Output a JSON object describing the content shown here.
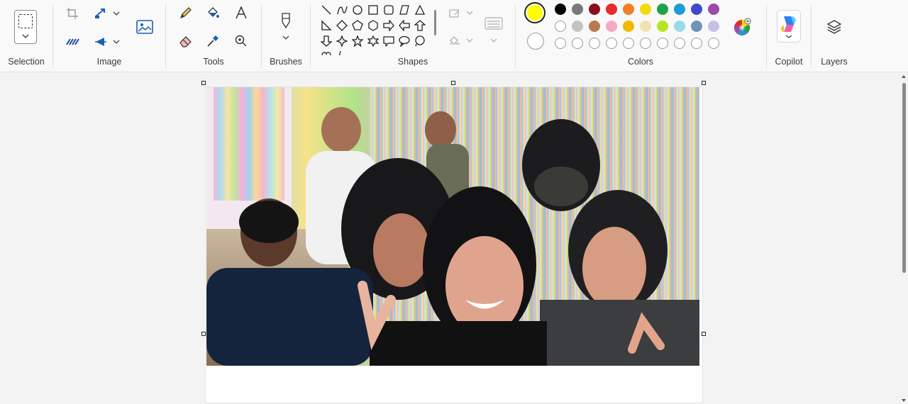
{
  "ribbon": {
    "groups": {
      "selection": "Selection",
      "image": "Image",
      "tools": "Tools",
      "brushes": "Brushes",
      "shapes": "Shapes",
      "colors": "Colors",
      "copilot": "Copilot",
      "layers": "Layers"
    }
  },
  "colors": {
    "primary": "#ffff00",
    "secondary": "#ffffff",
    "row1": [
      "#000000",
      "#7a7a7a",
      "#8b0e1a",
      "#e52b2b",
      "#f37f27",
      "#f5d90a",
      "#1fa24a",
      "#1e9bd8",
      "#3f48cc",
      "#9d49a8"
    ],
    "row2": [
      "#ffffff",
      "#c3c3c3",
      "#b9794f",
      "#f6a8c4",
      "#f4b800",
      "#efe4b0",
      "#b5e61d",
      "#99d9ea",
      "#7092be",
      "#c8bfe7"
    ],
    "row3_empty_count": 10
  },
  "canvas": {
    "image_description_name": "group-selfie-photo"
  }
}
